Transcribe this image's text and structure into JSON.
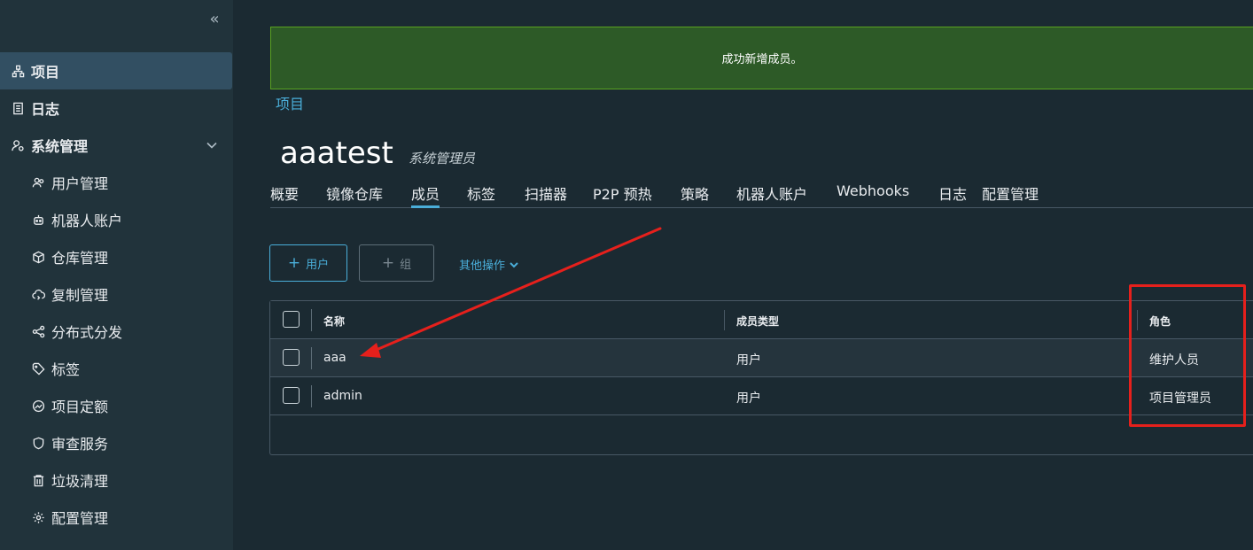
{
  "sidebar": {
    "collapse_glyph": "«",
    "items": [
      {
        "label": "项目",
        "icon": "project-icon",
        "active": true
      },
      {
        "label": "日志",
        "icon": "log-icon"
      },
      {
        "label": "系统管理",
        "icon": "admin-icon",
        "expanded": true
      },
      {
        "label": "用户管理",
        "icon": "users-icon"
      },
      {
        "label": "机器人账户",
        "icon": "robot-icon"
      },
      {
        "label": "仓库管理",
        "icon": "cube-icon"
      },
      {
        "label": "复制管理",
        "icon": "cloud-sync-icon"
      },
      {
        "label": "分布式分发",
        "icon": "share-icon"
      },
      {
        "label": "标签",
        "icon": "tag-icon"
      },
      {
        "label": "项目定额",
        "icon": "quota-icon"
      },
      {
        "label": "审查服务",
        "icon": "shield-icon"
      },
      {
        "label": "垃圾清理",
        "icon": "trash-icon"
      },
      {
        "label": "配置管理",
        "icon": "gear-icon"
      }
    ]
  },
  "banner": {
    "message": "成功新增成员。"
  },
  "breadcrumb": "项目",
  "page": {
    "title": "aaatest",
    "role": "系统管理员"
  },
  "tabs": [
    "概要",
    "镜像仓库",
    "成员",
    "标签",
    "扫描器",
    "P2P 预热",
    "策略",
    "机器人账户",
    "Webhooks",
    "日志",
    "配置管理"
  ],
  "active_tab": "成员",
  "actions": {
    "add_user": "用户",
    "add_group": "组",
    "more": "其他操作"
  },
  "table": {
    "columns": [
      "名称",
      "成员类型",
      "角色"
    ],
    "rows": [
      {
        "name": "aaa",
        "type": "用户",
        "role": "维护人员"
      },
      {
        "name": "admin",
        "type": "用户",
        "role": "项目管理员"
      }
    ]
  },
  "colors": {
    "accent": "#4aaed9",
    "success_banner": "#2d5a27",
    "annotation": "#e6201c"
  }
}
